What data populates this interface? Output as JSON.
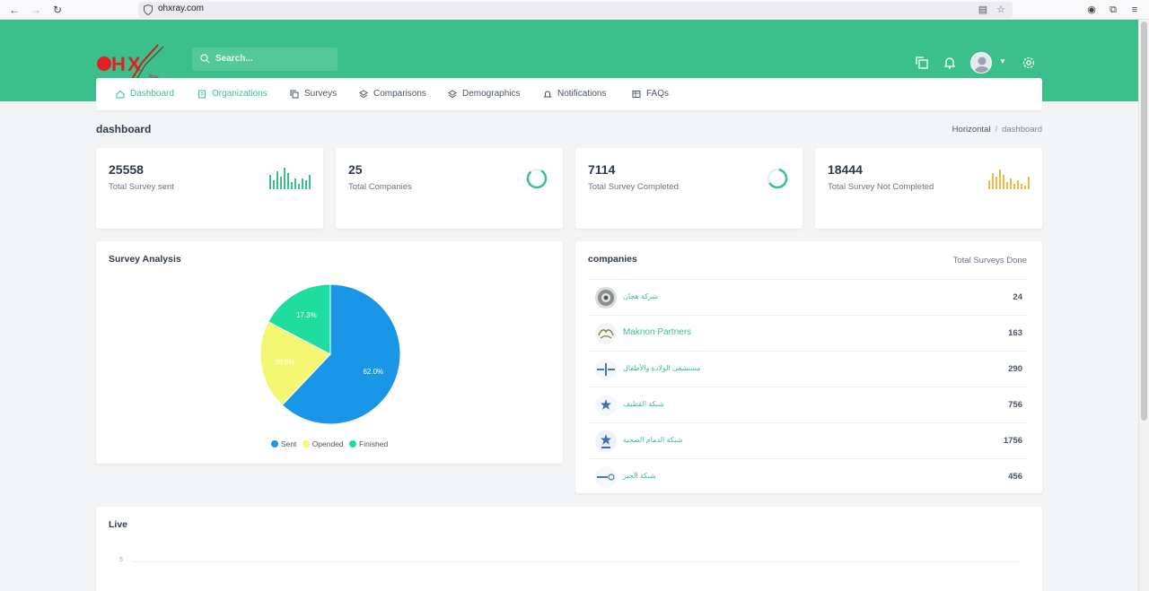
{
  "browser": {
    "url": "ohxray.com"
  },
  "header": {
    "logo_text": "OHX",
    "logo_sub": "Ray",
    "search_placeholder": "Search..."
  },
  "menu": {
    "items": [
      {
        "label": "Dashboard",
        "icon": "home-icon"
      },
      {
        "label": "Organizations",
        "icon": "building-icon"
      },
      {
        "label": "Surveys",
        "icon": "copy-icon"
      },
      {
        "label": "Comparisons",
        "icon": "layers-icon"
      },
      {
        "label": "Demographics",
        "icon": "layers-icon"
      },
      {
        "label": "Notifications",
        "icon": "bell-icon"
      },
      {
        "label": "FAQs",
        "icon": "table-icon"
      }
    ]
  },
  "page": {
    "title": "dashboard",
    "breadcrumb": {
      "parent": "Horizontal",
      "separator": "/",
      "current": "dashboard"
    }
  },
  "stats": [
    {
      "value": "25558",
      "label": "Total Survey sent",
      "graphic": "bar-sparkline",
      "color": "#3cc08b"
    },
    {
      "value": "25",
      "label": "Total Companies",
      "graphic": "radial",
      "color": "#3cc08b"
    },
    {
      "value": "7114",
      "label": "Total Survey Completed",
      "graphic": "radial",
      "color": "#3cc08b"
    },
    {
      "value": "18444",
      "label": "Total Survey Not Completed",
      "graphic": "bar-sparkline",
      "color": "#f5b942"
    }
  ],
  "survey_analysis": {
    "title": "Survey Analysis"
  },
  "chart_data": {
    "type": "pie",
    "title": "Survey Analysis",
    "categories": [
      "Sent",
      "Opended",
      "Finished"
    ],
    "values": [
      62.0,
      20.6,
      17.3
    ],
    "value_labels": [
      "62.0%",
      "20.6%",
      "17.3%"
    ],
    "colors": [
      "#1a96e6",
      "#f4f771",
      "#1fdc9f"
    ],
    "legend_position": "bottom"
  },
  "companies": {
    "title": "companies",
    "column_label": "Total Surveys Done",
    "rows": [
      {
        "name": "شركة هجان",
        "count": "24"
      },
      {
        "name": "Maknon Partners",
        "count": "163"
      },
      {
        "name": "مستشفى الولادة والأطفال",
        "count": "290"
      },
      {
        "name": "شبكة القطيف",
        "count": "756"
      },
      {
        "name": "شبكة الدمام الصحية",
        "count": "1756"
      },
      {
        "name": "شبكة الجبر",
        "count": "456"
      }
    ]
  },
  "live": {
    "title": "Live",
    "y_tick": "5"
  },
  "colors": {
    "brand_green": "#3cc08b",
    "page_bg": "#f3f4f6"
  }
}
